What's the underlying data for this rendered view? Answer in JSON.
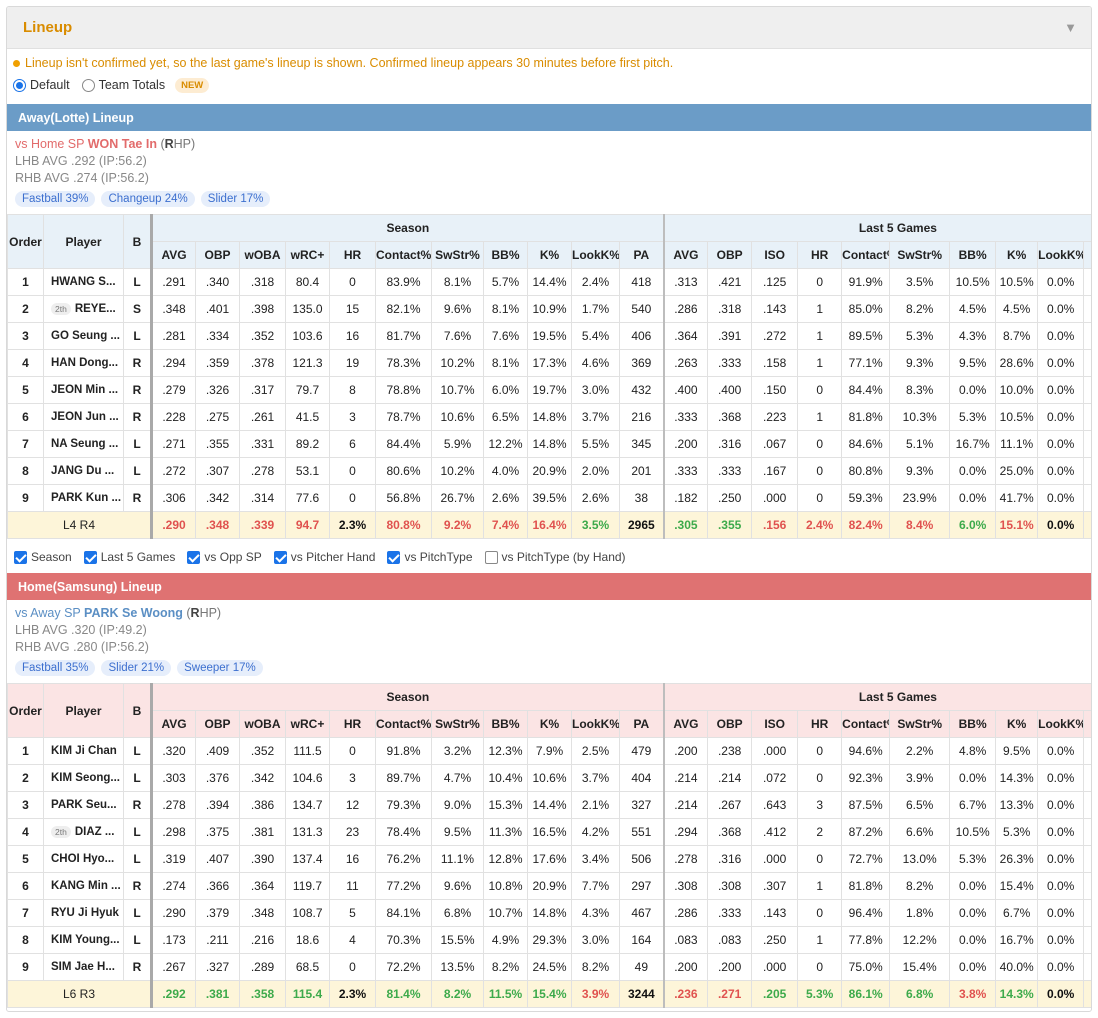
{
  "panel": {
    "title": "Lineup",
    "caret": "▼"
  },
  "notice": "Lineup isn't confirmed yet, so the last game's lineup is shown. Confirmed lineup appears 30 minutes before first pitch.",
  "modes": {
    "default": "Default",
    "team_totals": "Team Totals",
    "new_badge": "NEW"
  },
  "checks": [
    "Season",
    "Last 5 Games",
    "vs Opp SP",
    "vs Pitcher Hand",
    "vs PitchType",
    "vs PitchType (by Hand)"
  ],
  "checks_on": [
    true,
    true,
    true,
    true,
    true,
    false
  ],
  "headers": {
    "order": "Order",
    "player": "Player",
    "bat": "B",
    "season": "Season",
    "last5": "Last 5 Games",
    "season_cols": [
      "AVG",
      "OBP",
      "wOBA",
      "wRC+",
      "HR",
      "Contact%",
      "SwStr%",
      "BB%",
      "K%",
      "LookK%",
      "PA"
    ],
    "last5_cols": [
      "AVG",
      "OBP",
      "ISO",
      "HR",
      "Contact%",
      "SwStr%",
      "BB%",
      "K%",
      "LookK%"
    ]
  },
  "away": {
    "bar": "Away(Lotte) Lineup",
    "sp_prefix": "vs Home SP",
    "sp_name": "WON Tae In",
    "sp_hand_open": "(",
    "sp_hand_bold": "R",
    "sp_hand_rest": "HP)",
    "lhb": "LHB AVG .292 (IP:56.2)",
    "rhb": "RHB AVG .274 (IP:56.2)",
    "pitches": [
      "Fastball 39%",
      "Changeup 24%",
      "Slider 17%"
    ],
    "rows": [
      {
        "order": "1",
        "tag": "",
        "player": "HWANG S...",
        "bat": "L",
        "season": [
          ".291",
          ".340",
          ".318",
          "80.4",
          "0",
          "83.9%",
          "8.1%",
          "5.7%",
          "14.4%",
          "2.4%",
          "418"
        ],
        "last5": [
          ".313",
          ".421",
          ".125",
          "0",
          "91.9%",
          "3.5%",
          "10.5%",
          "10.5%",
          "0.0%"
        ]
      },
      {
        "order": "2",
        "tag": "2th",
        "player": "REYE...",
        "bat": "S",
        "season": [
          ".348",
          ".401",
          ".398",
          "135.0",
          "15",
          "82.1%",
          "9.6%",
          "8.1%",
          "10.9%",
          "1.7%",
          "540"
        ],
        "last5": [
          ".286",
          ".318",
          ".143",
          "1",
          "85.0%",
          "8.2%",
          "4.5%",
          "4.5%",
          "0.0%"
        ]
      },
      {
        "order": "3",
        "tag": "",
        "player": "GO Seung ...",
        "bat": "L",
        "season": [
          ".281",
          ".334",
          ".352",
          "103.6",
          "16",
          "81.7%",
          "7.6%",
          "7.6%",
          "19.5%",
          "5.4%",
          "406"
        ],
        "last5": [
          ".364",
          ".391",
          ".272",
          "1",
          "89.5%",
          "5.3%",
          "4.3%",
          "8.7%",
          "0.0%"
        ]
      },
      {
        "order": "4",
        "tag": "",
        "player": "HAN Dong...",
        "bat": "R",
        "season": [
          ".294",
          ".359",
          ".378",
          "121.3",
          "19",
          "78.3%",
          "10.2%",
          "8.1%",
          "17.3%",
          "4.6%",
          "369"
        ],
        "last5": [
          ".263",
          ".333",
          ".158",
          "1",
          "77.1%",
          "9.3%",
          "9.5%",
          "28.6%",
          "0.0%"
        ]
      },
      {
        "order": "5",
        "tag": "",
        "player": "JEON Min ...",
        "bat": "R",
        "season": [
          ".279",
          ".326",
          ".317",
          "79.7",
          "8",
          "78.8%",
          "10.7%",
          "6.0%",
          "19.7%",
          "3.0%",
          "432"
        ],
        "last5": [
          ".400",
          ".400",
          ".150",
          "0",
          "84.4%",
          "8.3%",
          "0.0%",
          "10.0%",
          "0.0%"
        ]
      },
      {
        "order": "6",
        "tag": "",
        "player": "JEON Jun ...",
        "bat": "R",
        "season": [
          ".228",
          ".275",
          ".261",
          "41.5",
          "3",
          "78.7%",
          "10.6%",
          "6.5%",
          "14.8%",
          "3.7%",
          "216"
        ],
        "last5": [
          ".333",
          ".368",
          ".223",
          "1",
          "81.8%",
          "10.3%",
          "5.3%",
          "10.5%",
          "0.0%"
        ]
      },
      {
        "order": "7",
        "tag": "",
        "player": "NA Seung ...",
        "bat": "L",
        "season": [
          ".271",
          ".355",
          ".331",
          "89.2",
          "6",
          "84.4%",
          "5.9%",
          "12.2%",
          "14.8%",
          "5.5%",
          "345"
        ],
        "last5": [
          ".200",
          ".316",
          ".067",
          "0",
          "84.6%",
          "5.1%",
          "16.7%",
          "11.1%",
          "0.0%"
        ]
      },
      {
        "order": "8",
        "tag": "",
        "player": "JANG Du ...",
        "bat": "L",
        "season": [
          ".272",
          ".307",
          ".278",
          "53.1",
          "0",
          "80.6%",
          "10.2%",
          "4.0%",
          "20.9%",
          "2.0%",
          "201"
        ],
        "last5": [
          ".333",
          ".333",
          ".167",
          "0",
          "80.8%",
          "9.3%",
          "0.0%",
          "25.0%",
          "0.0%"
        ]
      },
      {
        "order": "9",
        "tag": "",
        "player": "PARK Kun ...",
        "bat": "R",
        "season": [
          ".306",
          ".342",
          ".314",
          "77.6",
          "0",
          "56.8%",
          "26.7%",
          "2.6%",
          "39.5%",
          "2.6%",
          "38"
        ],
        "last5": [
          ".182",
          ".250",
          ".000",
          "0",
          "59.3%",
          "23.9%",
          "0.0%",
          "41.7%",
          "0.0%"
        ]
      }
    ],
    "summary": {
      "label": "L4 R4",
      "season": [
        ".290",
        ".348",
        ".339",
        "94.7",
        "2.3%",
        "80.8%",
        "9.2%",
        "7.4%",
        "16.4%",
        "3.5%",
        "2965"
      ],
      "season_colors": [
        "red",
        "red",
        "red",
        "red",
        "black",
        "red",
        "red",
        "red",
        "red",
        "green",
        "black"
      ],
      "last5": [
        ".305",
        ".355",
        ".156",
        "2.4%",
        "82.4%",
        "8.4%",
        "6.0%",
        "15.1%",
        "0.0%"
      ],
      "last5_colors": [
        "green",
        "green",
        "red",
        "red",
        "red",
        "red",
        "green",
        "red",
        "black"
      ]
    }
  },
  "home": {
    "bar": "Home(Samsung) Lineup",
    "sp_prefix": "vs Away SP",
    "sp_name": "PARK Se Woong",
    "sp_hand_open": "(",
    "sp_hand_bold": "R",
    "sp_hand_rest": "HP)",
    "lhb": "LHB AVG .320 (IP:49.2)",
    "rhb": "RHB AVG .280 (IP:56.2)",
    "pitches": [
      "Fastball 35%",
      "Slider 21%",
      "Sweeper 17%"
    ],
    "rows": [
      {
        "order": "1",
        "tag": "",
        "player": "KIM Ji Chan",
        "bat": "L",
        "season": [
          ".320",
          ".409",
          ".352",
          "111.5",
          "0",
          "91.8%",
          "3.2%",
          "12.3%",
          "7.9%",
          "2.5%",
          "479"
        ],
        "last5": [
          ".200",
          ".238",
          ".000",
          "0",
          "94.6%",
          "2.2%",
          "4.8%",
          "9.5%",
          "0.0%"
        ]
      },
      {
        "order": "2",
        "tag": "",
        "player": "KIM Seong...",
        "bat": "L",
        "season": [
          ".303",
          ".376",
          ".342",
          "104.6",
          "3",
          "89.7%",
          "4.7%",
          "10.4%",
          "10.6%",
          "3.7%",
          "404"
        ],
        "last5": [
          ".214",
          ".214",
          ".072",
          "0",
          "92.3%",
          "3.9%",
          "0.0%",
          "14.3%",
          "0.0%"
        ]
      },
      {
        "order": "3",
        "tag": "",
        "player": "PARK Seu...",
        "bat": "R",
        "season": [
          ".278",
          ".394",
          ".386",
          "134.7",
          "12",
          "79.3%",
          "9.0%",
          "15.3%",
          "14.4%",
          "2.1%",
          "327"
        ],
        "last5": [
          ".214",
          ".267",
          ".643",
          "3",
          "87.5%",
          "6.5%",
          "6.7%",
          "13.3%",
          "0.0%"
        ]
      },
      {
        "order": "4",
        "tag": "2th",
        "player": "DIAZ ...",
        "bat": "L",
        "season": [
          ".298",
          ".375",
          ".381",
          "131.3",
          "23",
          "78.4%",
          "9.5%",
          "11.3%",
          "16.5%",
          "4.2%",
          "551"
        ],
        "last5": [
          ".294",
          ".368",
          ".412",
          "2",
          "87.2%",
          "6.6%",
          "10.5%",
          "5.3%",
          "0.0%"
        ]
      },
      {
        "order": "5",
        "tag": "",
        "player": "CHOI Hyo...",
        "bat": "L",
        "season": [
          ".319",
          ".407",
          ".390",
          "137.4",
          "16",
          "76.2%",
          "11.1%",
          "12.8%",
          "17.6%",
          "3.4%",
          "506"
        ],
        "last5": [
          ".278",
          ".316",
          ".000",
          "0",
          "72.7%",
          "13.0%",
          "5.3%",
          "26.3%",
          "0.0%"
        ]
      },
      {
        "order": "6",
        "tag": "",
        "player": "KANG Min ...",
        "bat": "R",
        "season": [
          ".274",
          ".366",
          ".364",
          "119.7",
          "11",
          "77.2%",
          "9.6%",
          "10.8%",
          "20.9%",
          "7.7%",
          "297"
        ],
        "last5": [
          ".308",
          ".308",
          ".307",
          "1",
          "81.8%",
          "8.2%",
          "0.0%",
          "15.4%",
          "0.0%"
        ]
      },
      {
        "order": "7",
        "tag": "",
        "player": "RYU Ji Hyuk",
        "bat": "L",
        "season": [
          ".290",
          ".379",
          ".348",
          "108.7",
          "5",
          "84.1%",
          "6.8%",
          "10.7%",
          "14.8%",
          "4.3%",
          "467"
        ],
        "last5": [
          ".286",
          ".333",
          ".143",
          "0",
          "96.4%",
          "1.8%",
          "0.0%",
          "6.7%",
          "0.0%"
        ]
      },
      {
        "order": "8",
        "tag": "",
        "player": "KIM Young...",
        "bat": "L",
        "season": [
          ".173",
          ".211",
          ".216",
          "18.6",
          "4",
          "70.3%",
          "15.5%",
          "4.9%",
          "29.3%",
          "3.0%",
          "164"
        ],
        "last5": [
          ".083",
          ".083",
          ".250",
          "1",
          "77.8%",
          "12.2%",
          "0.0%",
          "16.7%",
          "0.0%"
        ]
      },
      {
        "order": "9",
        "tag": "",
        "player": "SIM Jae H...",
        "bat": "R",
        "season": [
          ".267",
          ".327",
          ".289",
          "68.5",
          "0",
          "72.2%",
          "13.5%",
          "8.2%",
          "24.5%",
          "8.2%",
          "49"
        ],
        "last5": [
          ".200",
          ".200",
          ".000",
          "0",
          "75.0%",
          "15.4%",
          "0.0%",
          "40.0%",
          "0.0%"
        ]
      }
    ],
    "summary": {
      "label": "L6 R3",
      "season": [
        ".292",
        ".381",
        ".358",
        "115.4",
        "2.3%",
        "81.4%",
        "8.2%",
        "11.5%",
        "15.4%",
        "3.9%",
        "3244"
      ],
      "season_colors": [
        "green",
        "green",
        "green",
        "green",
        "black",
        "green",
        "green",
        "green",
        "green",
        "red",
        "black"
      ],
      "last5": [
        ".236",
        ".271",
        ".205",
        "5.3%",
        "86.1%",
        "6.8%",
        "3.8%",
        "14.3%",
        "0.0%"
      ],
      "last5_colors": [
        "red",
        "red",
        "green",
        "green",
        "green",
        "green",
        "red",
        "green",
        "black"
      ]
    }
  },
  "colors": {
    "accent": "#d98c00",
    "away_bar": "#6b9cc7",
    "home_bar": "#df7272",
    "summary_bg": "#fdf5d9",
    "stat_red": "#e0524f",
    "stat_green": "#3daa4b"
  }
}
